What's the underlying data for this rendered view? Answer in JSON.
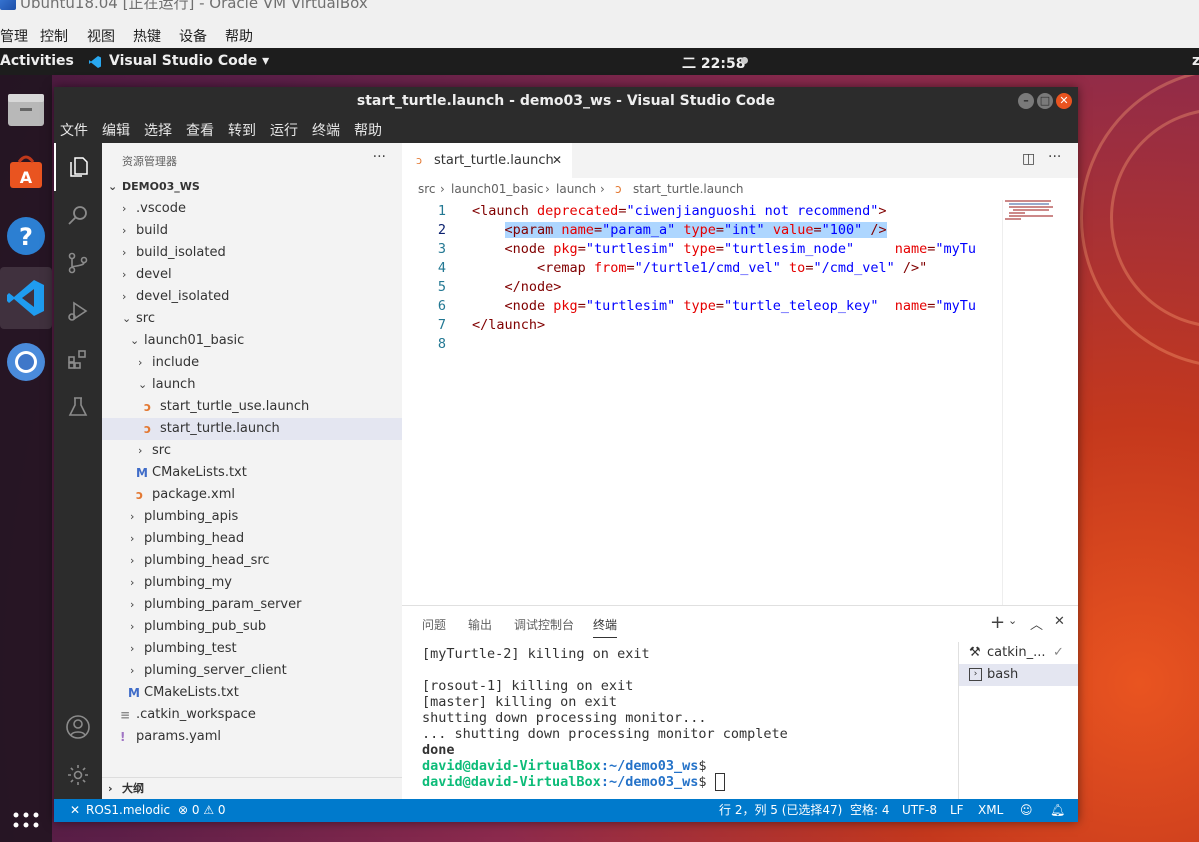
{
  "vbox": {
    "title": "Ubuntu18.04 [正在运行] - Oracle VM VirtualBox",
    "menu": [
      "管理",
      "控制",
      "视图",
      "热键",
      "设备",
      "帮助"
    ]
  },
  "ubuntu_topbar": {
    "activities": "Activities",
    "app": "Visual Studio Code ▾",
    "clock": "二 22:58",
    "right": "z"
  },
  "dock": {
    "items": [
      "files-icon",
      "software-center-icon",
      "help-icon",
      "vscode-icon",
      "chromium-icon",
      "apps-grid-icon"
    ]
  },
  "vscode": {
    "title": "start_turtle.launch - demo03_ws - Visual Studio Code",
    "menu": [
      "文件",
      "编辑",
      "选择",
      "查看",
      "转到",
      "运行",
      "终端",
      "帮助"
    ],
    "explorer": {
      "title": "资源管理器",
      "more": "···",
      "root": "DEMO03_WS",
      "tree": [
        {
          "label": ".vscode",
          "depth": 1,
          "kind": "folder",
          "open": false
        },
        {
          "label": "build",
          "depth": 1,
          "kind": "folder",
          "open": false
        },
        {
          "label": "build_isolated",
          "depth": 1,
          "kind": "folder",
          "open": false
        },
        {
          "label": "devel",
          "depth": 1,
          "kind": "folder",
          "open": false
        },
        {
          "label": "devel_isolated",
          "depth": 1,
          "kind": "folder",
          "open": false
        },
        {
          "label": "src",
          "depth": 1,
          "kind": "folder",
          "open": true
        },
        {
          "label": "launch01_basic",
          "depth": 2,
          "kind": "folder",
          "open": true
        },
        {
          "label": "include",
          "depth": 3,
          "kind": "folder",
          "open": false
        },
        {
          "label": "launch",
          "depth": 3,
          "kind": "folder",
          "open": true
        },
        {
          "label": "start_turtle_use.launch",
          "depth": 4,
          "kind": "rss"
        },
        {
          "label": "start_turtle.launch",
          "depth": 4,
          "kind": "rss",
          "selected": true
        },
        {
          "label": "src",
          "depth": 3,
          "kind": "folder",
          "open": false
        },
        {
          "label": "CMakeLists.txt",
          "depth": 3,
          "kind": "cmake"
        },
        {
          "label": "package.xml",
          "depth": 3,
          "kind": "rss"
        },
        {
          "label": "plumbing_apis",
          "depth": 2,
          "kind": "folder",
          "open": false
        },
        {
          "label": "plumbing_head",
          "depth": 2,
          "kind": "folder",
          "open": false
        },
        {
          "label": "plumbing_head_src",
          "depth": 2,
          "kind": "folder",
          "open": false
        },
        {
          "label": "plumbing_my",
          "depth": 2,
          "kind": "folder",
          "open": false
        },
        {
          "label": "plumbing_param_server",
          "depth": 2,
          "kind": "folder",
          "open": false
        },
        {
          "label": "plumbing_pub_sub",
          "depth": 2,
          "kind": "folder",
          "open": false
        },
        {
          "label": "plumbing_test",
          "depth": 2,
          "kind": "folder",
          "open": false
        },
        {
          "label": "pluming_server_client",
          "depth": 2,
          "kind": "folder",
          "open": false
        },
        {
          "label": "CMakeLists.txt",
          "depth": 2,
          "kind": "cmake"
        },
        {
          "label": ".catkin_workspace",
          "depth": 1,
          "kind": "text"
        },
        {
          "label": "params.yaml",
          "depth": 1,
          "kind": "yaml"
        }
      ],
      "outline": "大纲"
    },
    "tab": {
      "label": "start_turtle.launch",
      "close": "✕"
    },
    "breadcrumb": [
      "src",
      "launch01_basic",
      "launch",
      "start_turtle.launch"
    ],
    "code_lines": [
      {
        "n": "1",
        "tokens": [
          [
            "tg",
            "<launch "
          ],
          [
            "at",
            "deprecated"
          ],
          [
            "tg",
            "="
          ],
          [
            "st",
            "\"ciwenjianguoshi not recommend\""
          ],
          [
            "tg",
            ">"
          ]
        ]
      },
      {
        "n": "2",
        "tokens": [
          [
            "sp",
            "    "
          ],
          [
            "tg",
            "<param "
          ],
          [
            "at",
            "name"
          ],
          [
            "tg",
            "="
          ],
          [
            "st",
            "\"param_a\""
          ],
          [
            "tg",
            " "
          ],
          [
            "at",
            "type"
          ],
          [
            "tg",
            "="
          ],
          [
            "st",
            "\"int\""
          ],
          [
            "tg",
            " "
          ],
          [
            "at",
            "value"
          ],
          [
            "tg",
            "="
          ],
          [
            "st",
            "\"100\""
          ],
          [
            "tg",
            " />"
          ]
        ],
        "selected": true
      },
      {
        "n": "3",
        "tokens": [
          [
            "sp",
            "    "
          ],
          [
            "tg",
            "<node "
          ],
          [
            "at",
            "pkg"
          ],
          [
            "tg",
            "="
          ],
          [
            "st",
            "\"turtlesim\""
          ],
          [
            "tg",
            " "
          ],
          [
            "at",
            "type"
          ],
          [
            "tg",
            "="
          ],
          [
            "st",
            "\"turtlesim_node\""
          ],
          [
            "tg",
            "     "
          ],
          [
            "at",
            "name"
          ],
          [
            "tg",
            "="
          ],
          [
            "st",
            "\"myTu"
          ]
        ]
      },
      {
        "n": "4",
        "tokens": [
          [
            "sp",
            "        "
          ],
          [
            "tg",
            "<remap "
          ],
          [
            "at",
            "from"
          ],
          [
            "tg",
            "="
          ],
          [
            "st",
            "\"/turtle1/cmd_vel\""
          ],
          [
            "tg",
            " "
          ],
          [
            "at",
            "to"
          ],
          [
            "tg",
            "="
          ],
          [
            "st",
            "\"/cmd_vel\""
          ],
          [
            "tg",
            " />\""
          ]
        ]
      },
      {
        "n": "5",
        "tokens": [
          [
            "sp",
            "    "
          ],
          [
            "tg",
            "</node>"
          ]
        ]
      },
      {
        "n": "6",
        "tokens": [
          [
            "sp",
            "    "
          ],
          [
            "tg",
            "<node "
          ],
          [
            "at",
            "pkg"
          ],
          [
            "tg",
            "="
          ],
          [
            "st",
            "\"turtlesim\""
          ],
          [
            "tg",
            " "
          ],
          [
            "at",
            "type"
          ],
          [
            "tg",
            "="
          ],
          [
            "st",
            "\"turtle_teleop_key\""
          ],
          [
            "tg",
            "  "
          ],
          [
            "at",
            "name"
          ],
          [
            "tg",
            "="
          ],
          [
            "st",
            "\"myTu"
          ]
        ]
      },
      {
        "n": "7",
        "tokens": [
          [
            "tg",
            "</launch>"
          ]
        ]
      },
      {
        "n": "8",
        "tokens": []
      }
    ],
    "panel": {
      "tabs": [
        "问题",
        "输出",
        "调试控制台",
        "终端"
      ],
      "active_tab": "终端",
      "terminal_lines": [
        {
          "text": "[myTurtle-2] killing on exit"
        },
        {
          "text": ""
        },
        {
          "text": "[rosout-1] killing on exit"
        },
        {
          "text": "[master] killing on exit"
        },
        {
          "text": "shutting down processing monitor..."
        },
        {
          "text": "... shutting down processing monitor complete"
        },
        {
          "text": "done",
          "bold": true
        },
        {
          "prompt": "david@david-VirtualBox",
          "path": ":~/demo03_ws",
          "tail": "$"
        },
        {
          "prompt": "david@david-VirtualBox",
          "path": ":~/demo03_ws",
          "tail": "$ ",
          "cursor": true
        }
      ],
      "terminals": [
        {
          "label": "catkin_...",
          "icon": "tools-icon",
          "check": "✓"
        },
        {
          "label": "bash",
          "icon": "terminal-icon",
          "selected": true
        }
      ]
    },
    "status": {
      "remote": "✕",
      "ros": "ROS1.melodic",
      "errors": "⊗ 0 ⚠ 0",
      "cursor": "行 2，列 5 (已选择47)",
      "spaces": "空格: 4",
      "encoding": "UTF-8",
      "eol": "LF",
      "language": "XML"
    },
    "colors": {
      "accent": "#007acc",
      "ubuntu_orange": "#e95420"
    }
  }
}
